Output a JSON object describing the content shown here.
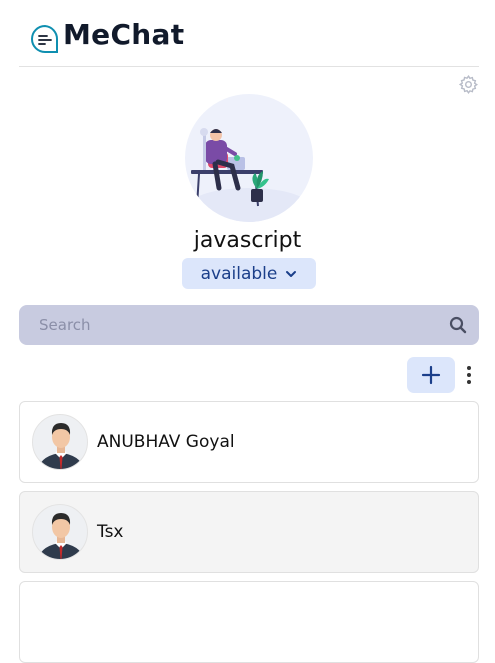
{
  "app": {
    "name": "MeChat"
  },
  "profile": {
    "name": "javascript",
    "status": "available"
  },
  "search": {
    "placeholder": "Search"
  },
  "contacts": [
    {
      "name": "ANUBHAV Goyal"
    },
    {
      "name": "Tsx"
    }
  ],
  "colors": {
    "brand": "#1b3f8a",
    "accent_bg": "#dce6fb",
    "search_bg": "#c8cbe0"
  },
  "icons": {
    "logo": "chat-bubble-icon",
    "settings": "gear-icon",
    "status": "chevron-down-icon",
    "search": "search-icon",
    "add": "plus-icon",
    "more": "kebab-menu-icon"
  }
}
